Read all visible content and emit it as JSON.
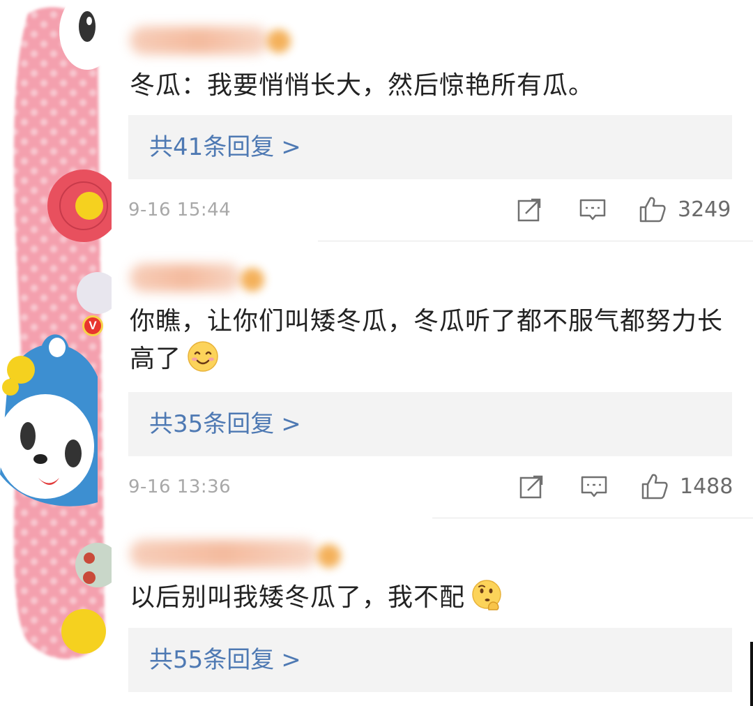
{
  "comments": [
    {
      "text": "冬瓜：我要悄悄长大，然后惊艳所有瓜。",
      "replies": "共41条回复",
      "chevron": ">",
      "timestamp": "9-16 15:44",
      "likes": "3249"
    },
    {
      "text": "你瞧，让你们叫矮冬瓜，冬瓜听了都不服气都努力长高了",
      "replies": "共35条回复",
      "chevron": ">",
      "timestamp": "9-16 13:36",
      "likes": "1488",
      "avatar_badge": "V"
    },
    {
      "text": "以后别叫我矮冬瓜了，我不配",
      "replies": "共55条回复",
      "chevron": ">"
    }
  ],
  "icons": {
    "repost": "repost-icon",
    "comment": "comment-icon",
    "like": "thumbs-up-icon",
    "smile_emoji": "smiling-face-emoji",
    "thinking_emoji": "thinking-face-emoji"
  },
  "colors": {
    "link": "#4e79b3",
    "reply_box_bg": "#f3f3f3",
    "timestamp": "#a8a8a8",
    "text": "#222222",
    "sticker_pink": "#f4a5b2"
  }
}
